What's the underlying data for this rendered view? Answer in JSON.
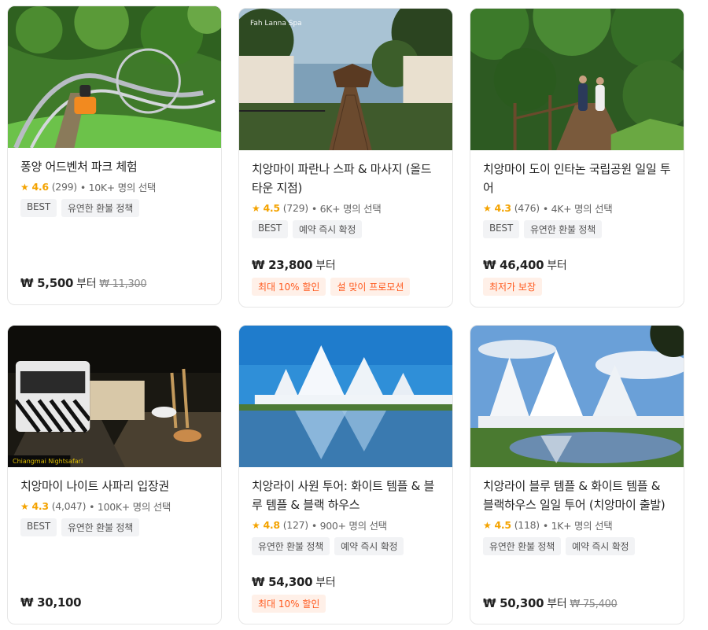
{
  "cards": [
    {
      "title": "퐁양 어드벤처 파크 체험",
      "score": "4.6",
      "reviews": "(299)",
      "booked": "• 10K+ 명의 선택",
      "tags": [
        "BEST",
        "유연한 환불 정책"
      ],
      "price": "₩ 5,500",
      "from": "부터",
      "original_price": "₩ 11,300",
      "promos": []
    },
    {
      "title": "치앙마이 파란나 스파 & 마사지 (올드 타운 지점)",
      "watermark": "Fah Lanna Spa",
      "score": "4.5",
      "reviews": "(729)",
      "booked": "• 6K+ 명의 선택",
      "tags": [
        "BEST",
        "예약 즉시 확정"
      ],
      "price": "₩ 23,800",
      "from": "부터",
      "original_price": "",
      "promos": [
        "최대 10% 할인",
        "설 맞이 프로모션"
      ]
    },
    {
      "title": "치앙마이 도이 인타논 국립공원 일일 투어",
      "score": "4.3",
      "reviews": "(476)",
      "booked": "• 4K+ 명의 선택",
      "tags": [
        "BEST",
        "유연한 환불 정책"
      ],
      "price": "₩ 46,400",
      "from": "부터",
      "original_price": "",
      "promos": [
        "최저가 보장"
      ]
    },
    {
      "title": "치앙마이 나이트 사파리 입장권",
      "watermark": "Chiangmai Nightsafari",
      "score": "4.3",
      "reviews": "(4,047)",
      "booked": "• 100K+ 명의 선택",
      "tags": [
        "BEST",
        "유연한 환불 정책"
      ],
      "price": "₩ 30,100",
      "from": "",
      "original_price": "",
      "promos": []
    },
    {
      "title": "치앙라이 사원 투어: 화이트 템플 & 블루 템플 & 블랙 하우스",
      "score": "4.8",
      "reviews": "(127)",
      "booked": "• 900+ 명의 선택",
      "tags": [
        "유연한 환불 정책",
        "예약 즉시 확정"
      ],
      "price": "₩ 54,300",
      "from": "부터",
      "original_price": "",
      "promos": [
        "최대 10% 할인"
      ]
    },
    {
      "title": "치앙라이 블루 템플 & 화이트 템플 & 블랙하우스 일일 투어 (치앙마이 출발)",
      "score": "4.5",
      "reviews": "(118)",
      "booked": "• 1K+ 명의 선택",
      "tags": [
        "유연한 환불 정책",
        "예약 즉시 확정"
      ],
      "price": "₩ 50,300",
      "from": "부터",
      "original_price": "₩ 75,400",
      "promos": []
    }
  ],
  "colors": {
    "star": "#f4a300",
    "promo_text": "#ff5a1f",
    "promo_bg": "#fff0e8",
    "tag_bg": "#f2f3f5"
  }
}
